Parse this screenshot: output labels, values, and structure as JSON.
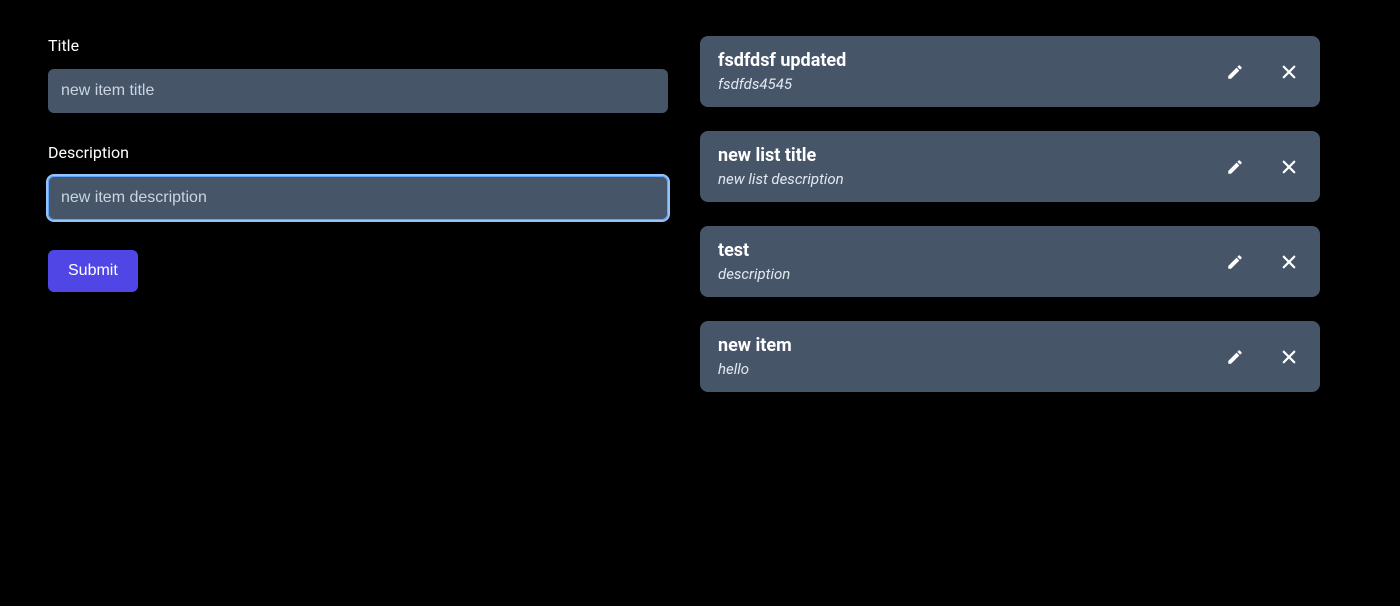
{
  "form": {
    "title_label": "Title",
    "title_placeholder": "new item title",
    "title_value": "",
    "description_label": "Description",
    "description_placeholder": "new item description",
    "description_value": "",
    "submit_label": "Submit"
  },
  "items": [
    {
      "title": "fsdfdsf updated",
      "description": "fsdfds4545"
    },
    {
      "title": "new list title",
      "description": "new list description"
    },
    {
      "title": "test",
      "description": "description"
    },
    {
      "title": "new item",
      "description": "hello"
    }
  ]
}
